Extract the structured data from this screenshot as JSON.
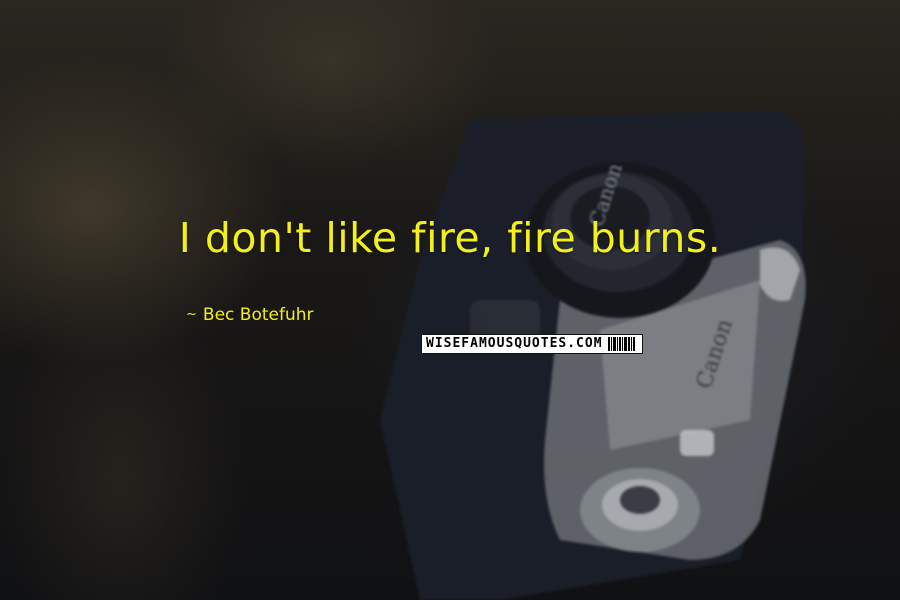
{
  "quote": {
    "text": "I don't like fire, fire burns.",
    "author": "Bec Botefuhr",
    "author_prefix": "~",
    "text_color": "#f3ef1b"
  },
  "watermark": {
    "text": "WISEFAMOUSQUOTES.COM"
  },
  "background": {
    "camera_brand": "Canon"
  }
}
